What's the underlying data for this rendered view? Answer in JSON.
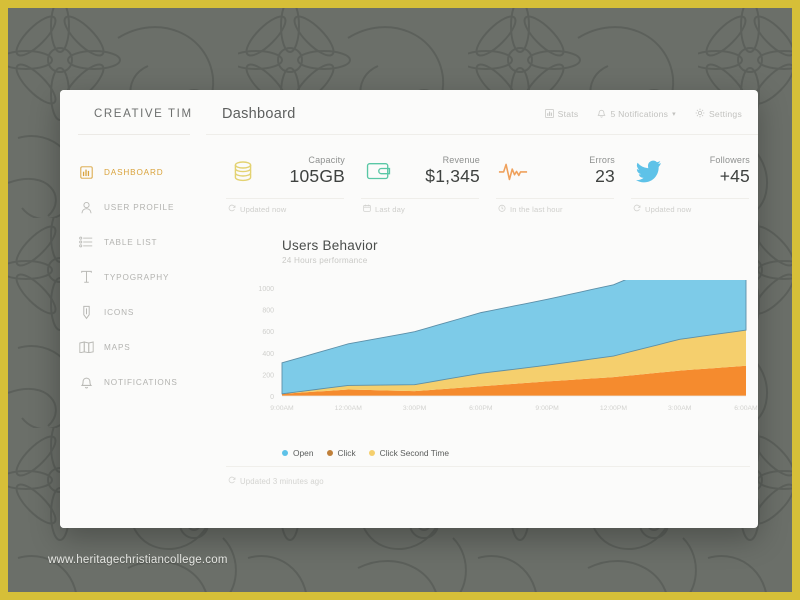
{
  "window": {
    "watermark": "www.heritagechristiancollege.com",
    "frame_color": "#d6bf38",
    "backdrop_color": "#6b6f69"
  },
  "sidebar": {
    "brand": "CREATIVE TIM",
    "active_color": "#d9a33c",
    "items": [
      {
        "label": "DASHBOARD",
        "icon": "dashboard-icon",
        "active": true
      },
      {
        "label": "USER PROFILE",
        "icon": "user-icon",
        "active": false
      },
      {
        "label": "TABLE LIST",
        "icon": "table-list-icon",
        "active": false
      },
      {
        "label": "TYPOGRAPHY",
        "icon": "typography-icon",
        "active": false
      },
      {
        "label": "ICONS",
        "icon": "pencil-icon",
        "active": false
      },
      {
        "label": "MAPS",
        "icon": "map-icon",
        "active": false
      },
      {
        "label": "NOTIFICATIONS",
        "icon": "bell-icon",
        "active": false
      }
    ]
  },
  "header": {
    "title": "Dashboard",
    "nav": [
      {
        "label": "Stats",
        "icon": "stats-icon",
        "caret": false
      },
      {
        "label": "5 Notifications",
        "icon": "bell-icon",
        "caret": true
      },
      {
        "label": "Settings",
        "icon": "gear-icon",
        "caret": false
      }
    ],
    "caret_glyph": "▾"
  },
  "stats": [
    {
      "icon": "database-icon",
      "icon_color": "#e8d878",
      "label": "Capacity",
      "value": "105GB",
      "foot_icon": "refresh-icon",
      "foot": "Updated now"
    },
    {
      "icon": "wallet-icon",
      "icon_color": "#5cc9a7",
      "label": "Revenue",
      "value": "$1,345",
      "foot_icon": "calendar-icon",
      "foot": "Last day"
    },
    {
      "icon": "pulse-icon",
      "icon_color": "#f0a35e",
      "label": "Errors",
      "value": "23",
      "foot_icon": "clock-icon",
      "foot": "In the last hour"
    },
    {
      "icon": "twitter-icon",
      "icon_color": "#5ec2e8",
      "label": "Followers",
      "value": "+45",
      "foot_icon": "refresh-icon",
      "foot": "Updated now"
    }
  ],
  "chart_panel": {
    "title": "Users Behavior",
    "subtitle": "24 Hours performance",
    "footer_icon": "refresh-icon",
    "footer": "Updated 3 minutes ago"
  },
  "chart_data": {
    "type": "area",
    "stacked": true,
    "title": "Users Behavior",
    "subtitle": "24 Hours performance",
    "xlabel": "",
    "ylabel": "",
    "ylim": [
      0,
      1000
    ],
    "yticks": [
      "0",
      "200",
      "400",
      "600",
      "800",
      "1000"
    ],
    "grid": false,
    "legend_position": "bottom-left",
    "x": [
      "9:00AM",
      "12:00AM",
      "3:00PM",
      "6:00PM",
      "9:00PM",
      "12:00PM",
      "3:00AM",
      "6:00AM"
    ],
    "categories": [
      "9:00AM",
      "12:00AM",
      "3:00PM",
      "6:00PM",
      "9:00PM",
      "12:00PM",
      "3:00AM",
      "6:00AM"
    ],
    "series": [
      {
        "name": "Open",
        "color": "#7dcbe8",
        "values": [
          287,
          385,
          490,
          562,
          610,
          660,
          760,
          800
        ]
      },
      {
        "name": "Click",
        "color": "#c0803a",
        "values": [
          20,
          60,
          45,
          90,
          135,
          175,
          235,
          280
        ]
      },
      {
        "name": "Click Second Time",
        "color": "#f5cf6d",
        "values": [
          0,
          38,
          60,
          120,
          150,
          195,
          290,
          330
        ]
      }
    ],
    "series_fill_colors": {
      "open": "#7dcbe8",
      "click": "#f58b2e",
      "click_second_time": "#f5cf6d"
    },
    "stack_order": [
      "Click",
      "Click Second Time",
      "Open"
    ]
  }
}
